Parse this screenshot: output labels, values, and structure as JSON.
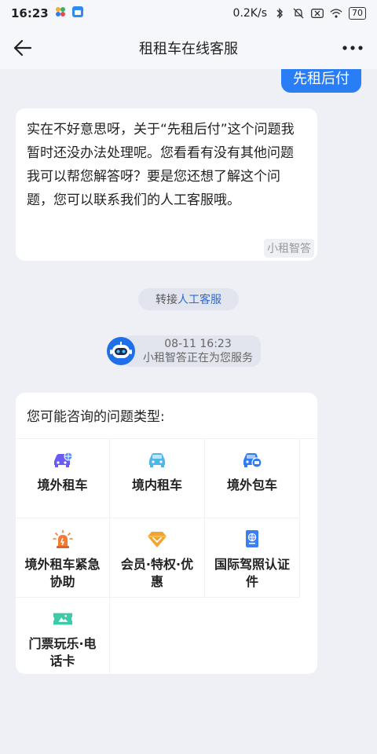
{
  "status_bar": {
    "time": "16:23",
    "network_speed": "0.2K/s",
    "battery": "70",
    "icons": [
      "app-icon-1",
      "app-icon-2",
      "bluetooth-icon",
      "mute-icon",
      "sim-x-icon",
      "wifi-icon",
      "battery-icon"
    ]
  },
  "header": {
    "title": "租租车在线客服",
    "back_icon": "arrow-left-icon",
    "more_icon": "ellipsis-icon"
  },
  "chat": {
    "user_message": "先租后付",
    "bot_message": "实在不好意思呀，关于“先租后付”这个问题我暂时还没办法处理呢。您看看有没有其他问题我可以帮您解答呀？要是您还想了解这个问题，您可以联系我们的人工客服哦。",
    "bot_tag": "小租智答",
    "transfer": {
      "prefix": "转接",
      "link": "人工客服"
    },
    "service_notice": {
      "time": "08-11 16:23",
      "text": "小租智答正在为您服务"
    }
  },
  "question_card": {
    "title": "您可能咨询的问题类型:",
    "items": [
      {
        "label": "境外租车",
        "icon": "car-globe-icon",
        "color": "#6a5cf0"
      },
      {
        "label": "境内租车",
        "icon": "car-icon",
        "color": "#4fb6e8"
      },
      {
        "label": "境外包车",
        "icon": "car-chat-icon",
        "color": "#2f7df0"
      },
      {
        "label": "境外租车紧急协助",
        "icon": "alert-light-icon",
        "color": "#f27b36"
      },
      {
        "label": "会员·特权·优惠",
        "icon": "gem-icon",
        "color": "#f2a52c"
      },
      {
        "label": "国际驾照认证件",
        "icon": "passport-icon",
        "color": "#3b7ff0"
      },
      {
        "label": "门票玩乐·电话卡",
        "icon": "ticket-icon",
        "color": "#3ccaa8"
      }
    ]
  },
  "colors": {
    "accent": "#2a7ef5",
    "background": "#eef0f6"
  }
}
